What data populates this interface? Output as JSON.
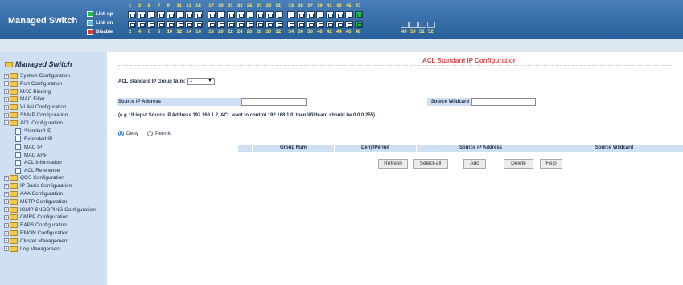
{
  "header": {
    "brand": "Managed Switch",
    "legend": {
      "up": "Link up",
      "dn": "Link dn",
      "disable": "Disable"
    },
    "colors": {
      "up": "#23b94a",
      "dn": "#5fb4e8",
      "disable": "#e03a2e"
    },
    "odd_port_numbers": [
      "1",
      "3",
      "5",
      "7",
      "9",
      "11",
      "13",
      "15",
      "17",
      "19",
      "21",
      "23",
      "25",
      "27",
      "29",
      "31",
      "33",
      "35",
      "37",
      "39",
      "41",
      "43",
      "45",
      "47"
    ],
    "even_port_numbers": [
      "2",
      "4",
      "6",
      "8",
      "10",
      "12",
      "14",
      "16",
      "18",
      "20",
      "22",
      "24",
      "26",
      "28",
      "30",
      "32",
      "34",
      "36",
      "38",
      "40",
      "42",
      "44",
      "46",
      "48"
    ],
    "sfp_numbers": [
      "49",
      "50",
      "51",
      "52"
    ],
    "ports_up": [
      "47",
      "48"
    ]
  },
  "sidebar": {
    "title": "Managed Switch",
    "items": [
      "System Configuration",
      "Port Configuration",
      "MAC Binding",
      "MAC Filter",
      "VLAN Configuration",
      "SNMP Configuration",
      "ACL Configuration",
      "Standard IP",
      "Extended IP",
      "MAC IP",
      "MAC ARP",
      "ACL Information",
      "ACL Reference",
      "QOS Configuration",
      "IP Basic Configuration",
      "AAA Configuration",
      "MSTP Configuration",
      "IGMP SNOOPING Configuration",
      "GMRP Configuration",
      "EAPS Configuration",
      "RMON Configuration",
      "Cluster Management",
      "Log Management"
    ]
  },
  "main": {
    "title": "ACL Standard IP Configuration",
    "group_label": "ACL Standard IP Group Num:",
    "group_value": "1",
    "source_ip_label": "Source IP Address",
    "source_ip_value": "",
    "source_wildcard_label": "Source Wildcard",
    "source_wildcard_value": "",
    "hint": "(e.g.: If input Source IP Address 192.168.1.2, ACL want to control 192.168.1.0, then Wildcard should be 0.0.0.255)",
    "radio_deny": "Deny",
    "radio_permit": "Permit",
    "columns": [
      "Group Num",
      "Deny/Permit",
      "Source IP Address",
      "Source Wildcard"
    ],
    "buttons": {
      "refresh": "Refresh",
      "select_all": "Select-all",
      "add": "Add",
      "delete": "Delete",
      "help": "Help"
    }
  }
}
